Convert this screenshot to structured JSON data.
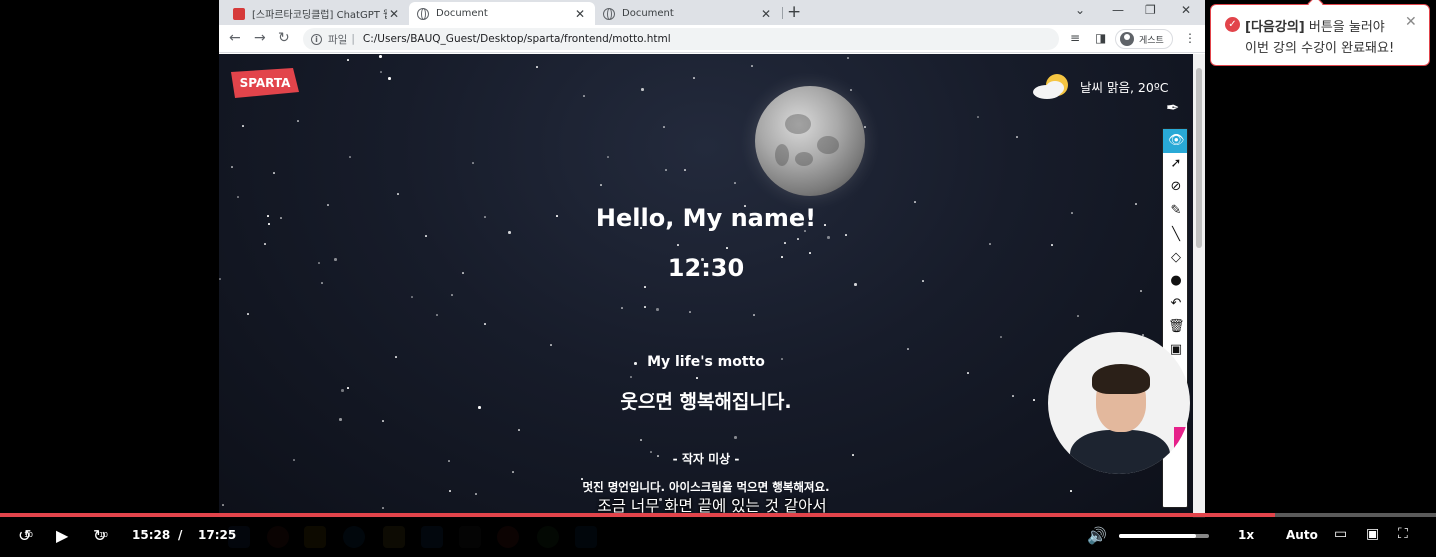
{
  "browser": {
    "tabs": [
      {
        "title": "[스파르타코딩클럽] ChatGPT 웹",
        "icon": "sparta-favicon",
        "active": false
      },
      {
        "title": "Document",
        "icon": "globe-icon",
        "active": true
      },
      {
        "title": "Document",
        "icon": "globe-icon",
        "active": false
      }
    ],
    "new_tab_label": "+",
    "address": {
      "scheme_label": "파일",
      "url": "C:/Users/BAUQ_Guest/Desktop/sparta/frontend/motto.html"
    },
    "profile_label": "게스트"
  },
  "page": {
    "logo_text": "SPARTA",
    "weather_text": "날씨 맑음, 20ºC",
    "greeting": "Hello, My name!",
    "clock": "12:30",
    "motto_title": "My life's motto",
    "motto_text": "웃으면 행복해집니다.",
    "author": "- 작자 미상 -",
    "quote": "멋진 명언입니다. 아이스크림을 먹으면 행복해져요."
  },
  "toast": {
    "bold": "[다음강의]",
    "line1_rest": " 버튼을 눌러야",
    "line2": "이번 강의 수강이 완료돼요!"
  },
  "subtitle": "조금 너무 화면 끝에 있는 것 같아서",
  "player": {
    "current_time": "15:28",
    "separator": "/",
    "duration": "17:25",
    "progress_fraction": 0.888,
    "volume_fraction": 0.85,
    "speed": "1x",
    "quality": "Auto",
    "rewind_label": "10",
    "forward_label": "10"
  },
  "colors": {
    "accent_red": "#e2444b",
    "palette_selected": "#29a9d6",
    "pink": "#e6218a"
  }
}
